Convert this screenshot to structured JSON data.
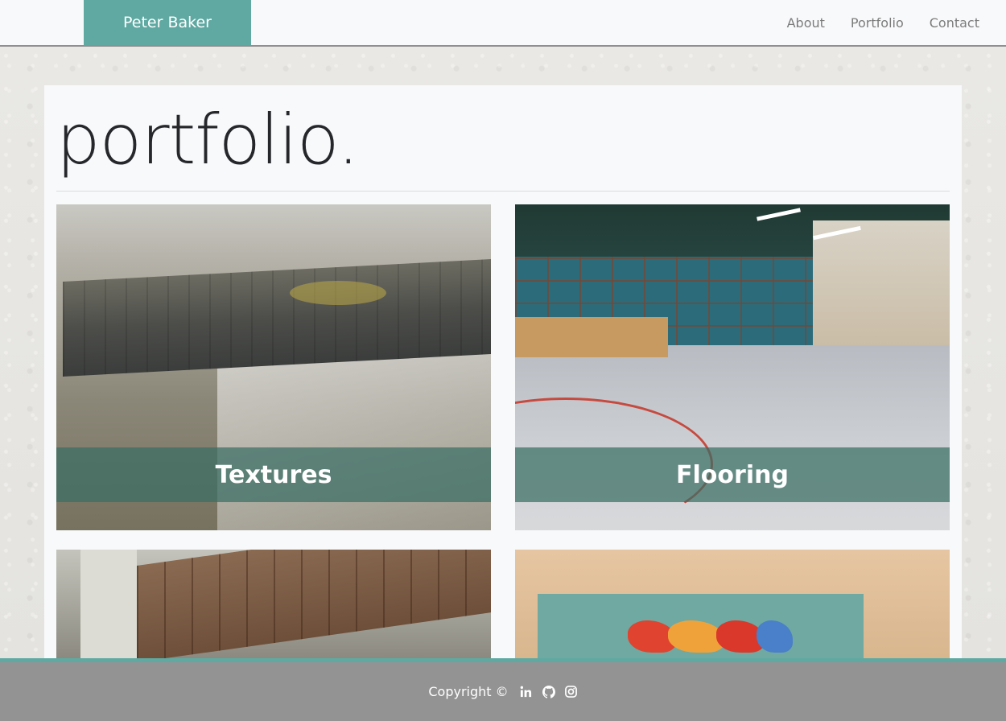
{
  "header": {
    "brand": "Peter Baker",
    "nav": [
      {
        "label": "About"
      },
      {
        "label": "Portfolio"
      },
      {
        "label": "Contact"
      }
    ]
  },
  "main": {
    "title": "portfolio.",
    "cards": [
      {
        "label": "Textures"
      },
      {
        "label": "Flooring"
      },
      {
        "label": ""
      },
      {
        "label": ""
      }
    ]
  },
  "footer": {
    "copyright": "Copyright ©",
    "icons": [
      "linkedin-icon",
      "github-icon",
      "instagram-icon"
    ]
  },
  "colors": {
    "accent": "#5fa9a2",
    "footer_bg": "#939393",
    "caption_bg": "#3a6e64"
  }
}
